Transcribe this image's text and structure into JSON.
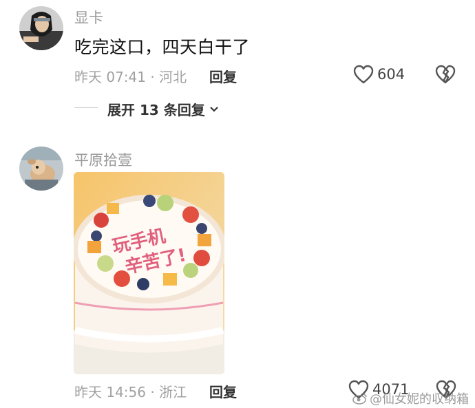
{
  "comments": [
    {
      "username": "显卡",
      "text": "吃完这口，四天白干了",
      "time_location": "昨天 07:41 · 河北",
      "reply_label": "回复",
      "like_count": "604",
      "expand_label": "展开 13 条回复"
    },
    {
      "username": "平原拾壹",
      "time_location": "昨天 14:56 · 浙江",
      "reply_label": "回复",
      "like_count": "4071",
      "photo_caption_line1": "玩手机",
      "photo_caption_line2": "辛苦了!"
    }
  ],
  "watermark": "@仙女妮的収纳箱",
  "colors": {
    "meta_gray": "#a0a0a0",
    "name_gray": "#9a9a9a",
    "cake_pink_text": "#e0607e"
  },
  "icons": [
    "heart-icon",
    "broken-heart-icon",
    "chevron-down-icon",
    "weibo-icon"
  ]
}
